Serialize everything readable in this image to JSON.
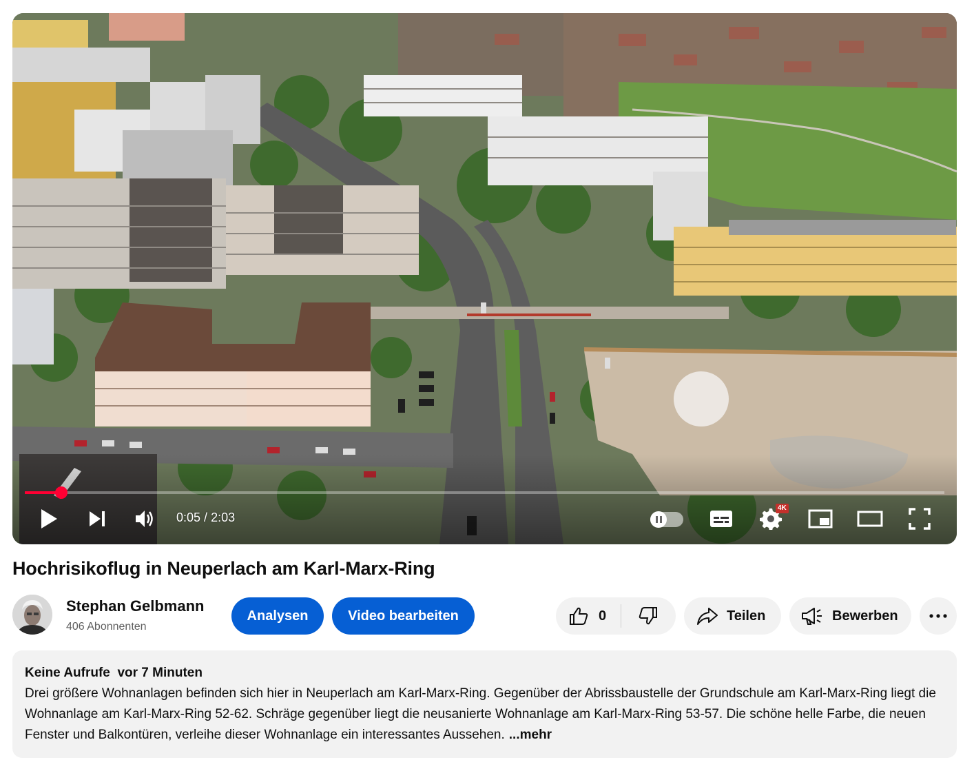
{
  "player": {
    "current_time": "0:05",
    "duration": "2:03",
    "time_separator": " / ",
    "progress_fraction": 0.04,
    "quality_badge": "4K",
    "accent_color": "#ff0033"
  },
  "video": {
    "title": "Hochrisikoflug in Neuperlach am Karl-Marx-Ring"
  },
  "channel": {
    "name": "Stephan Gelbmann",
    "subscribers": "406 Abonnenten"
  },
  "actions": {
    "analytics_label": "Analysen",
    "edit_label": "Video bearbeiten",
    "like_count": "0",
    "share_label": "Teilen",
    "promote_label": "Bewerben",
    "brand_color": "#065fd4"
  },
  "description": {
    "views": "Keine Aufrufe",
    "age": "vor 7 Minuten",
    "text": "Drei größere Wohnanlagen befinden sich hier in Neuperlach am Karl-Marx-Ring. Gegenüber der Abrissbaustelle der Grundschule am Karl-Marx-Ring liegt die Wohnanlage am Karl-Marx-Ring 52-62. Schräge gegenüber liegt die neusanierte Wohnanlage am Karl-Marx-Ring 53-57. Die schöne helle Farbe, die neuen Fenster und Balkontüren, verleihe dieser Wohnanlage ein interessantes Aussehen.",
    "more_label": "...mehr"
  },
  "icons": {
    "play": "play-icon",
    "next": "next-icon",
    "volume": "volume-icon",
    "autoplay": "autoplay-toggle",
    "subtitles": "subtitles-icon",
    "settings": "gear-icon",
    "miniplayer": "miniplayer-icon",
    "theater": "theater-mode-icon",
    "fullscreen": "fullscreen-icon",
    "like": "thumbs-up-icon",
    "dislike": "thumbs-down-icon",
    "share": "share-arrow-icon",
    "promote": "megaphone-icon",
    "more": "more-dots-icon"
  }
}
